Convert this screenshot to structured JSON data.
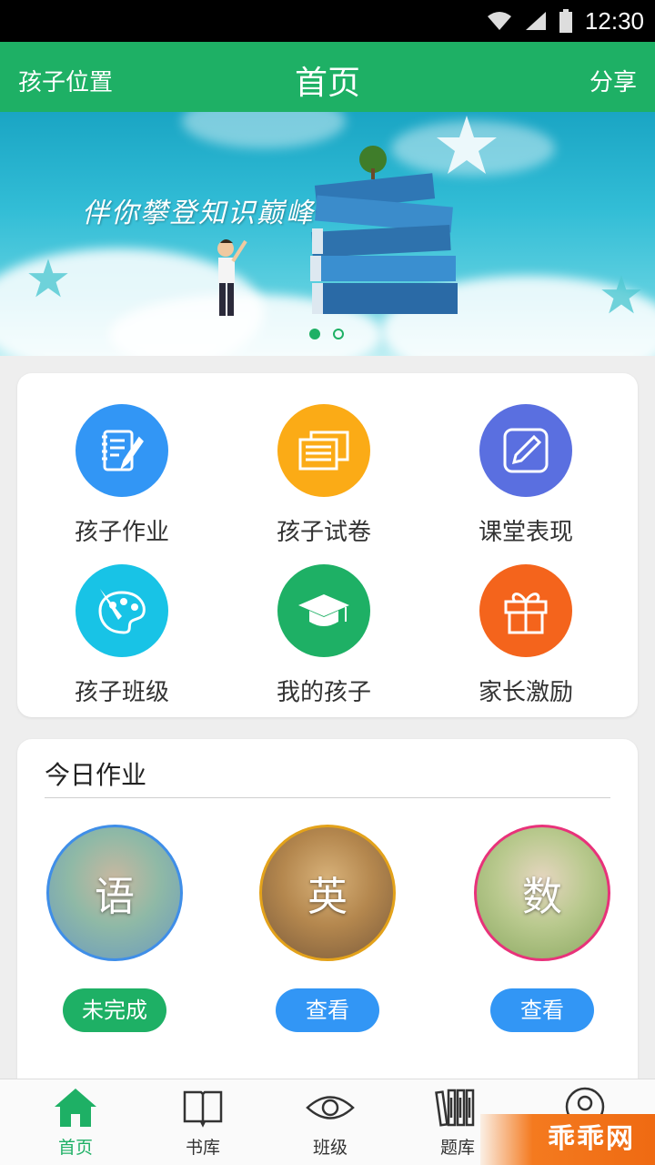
{
  "status_bar": {
    "time": "12:30"
  },
  "header": {
    "left_label": "孩子位置",
    "title": "首页",
    "right_label": "分享"
  },
  "banner": {
    "slogan": "伴你攀登知识巅峰",
    "slide_count": 2,
    "active_slide": 1
  },
  "features": [
    {
      "label": "孩子作业",
      "icon": "homework-notebook-icon",
      "color": "#3296f5"
    },
    {
      "label": "孩子试卷",
      "icon": "exam-paper-icon",
      "color": "#fbab16"
    },
    {
      "label": "课堂表现",
      "icon": "pencil-edit-icon",
      "color": "#5a6fe0"
    },
    {
      "label": "孩子班级",
      "icon": "palette-icon",
      "color": "#18c3e6"
    },
    {
      "label": "我的孩子",
      "icon": "graduation-cap-icon",
      "color": "#1eb065"
    },
    {
      "label": "家长激励",
      "icon": "gift-icon",
      "color": "#f4641c"
    }
  ],
  "homework": {
    "title": "今日作业",
    "subjects": [
      {
        "char": "语",
        "status_label": "未完成",
        "status_color": "#1eb065",
        "ring_color": "#3f8ee8"
      },
      {
        "char": "英",
        "status_label": "查看",
        "status_color": "#3296f5",
        "ring_color": "#e3a21a"
      },
      {
        "char": "数",
        "status_label": "查看",
        "status_color": "#3296f5",
        "ring_color": "#e8327a"
      }
    ]
  },
  "bottom_nav": [
    {
      "label": "首页",
      "icon": "home-icon",
      "active": true
    },
    {
      "label": "书库",
      "icon": "book-icon",
      "active": false
    },
    {
      "label": "班级",
      "icon": "eye-icon",
      "active": false
    },
    {
      "label": "题库",
      "icon": "bookshelf-icon",
      "active": false
    },
    {
      "label": "",
      "icon": "profile-icon",
      "active": false
    }
  ],
  "watermark": "乖乖网",
  "colors": {
    "primary": "#1eb065",
    "accent_blue": "#3296f5"
  }
}
